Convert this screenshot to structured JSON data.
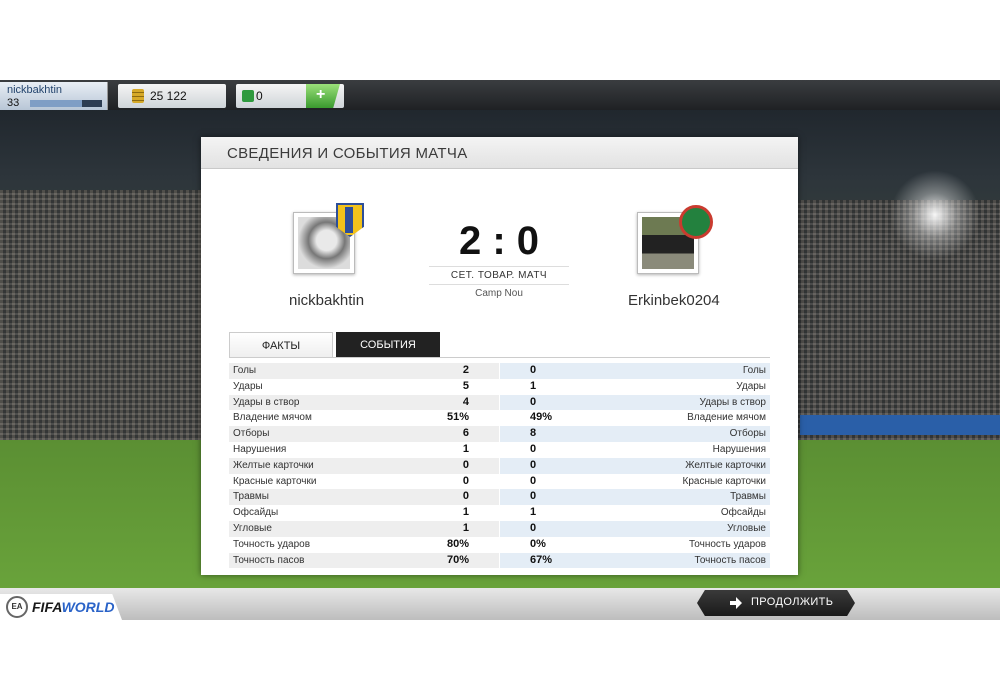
{
  "topbar": {
    "username": "nickbakhtin",
    "level": "33",
    "level_progress": 0.72,
    "coins": "25 122",
    "points": "0",
    "add_points_icon": "plus-icon"
  },
  "panel": {
    "title": "СВЕДЕНИЯ И СОБЫТИЯ МАТЧА",
    "home_player": "nickbakhtin",
    "away_player": "Erkinbek0204",
    "score": "2 : 0",
    "match_type": "СЕТ. ТОВАР. МАТЧ",
    "venue": "Camp Nou",
    "tabs": [
      {
        "label": "ФАКТЫ",
        "active": true
      },
      {
        "label": "СОБЫТИЯ",
        "active": false
      }
    ],
    "stats": [
      {
        "label": "Голы",
        "home": "2",
        "away": "0"
      },
      {
        "label": "Удары",
        "home": "5",
        "away": "1"
      },
      {
        "label": "Удары в створ",
        "home": "4",
        "away": "0"
      },
      {
        "label": "Владение мячом",
        "home": "51%",
        "away": "49%"
      },
      {
        "label": "Отборы",
        "home": "6",
        "away": "8"
      },
      {
        "label": "Нарушения",
        "home": "1",
        "away": "0"
      },
      {
        "label": "Желтые карточки",
        "home": "0",
        "away": "0"
      },
      {
        "label": "Красные карточки",
        "home": "0",
        "away": "0"
      },
      {
        "label": "Травмы",
        "home": "0",
        "away": "0"
      },
      {
        "label": "Офсайды",
        "home": "1",
        "away": "1"
      },
      {
        "label": "Угловые",
        "home": "1",
        "away": "0"
      },
      {
        "label": "Точность ударов",
        "home": "80%",
        "away": "0%"
      },
      {
        "label": "Точность пасов",
        "home": "70%",
        "away": "67%"
      }
    ]
  },
  "footer": {
    "logo_prefix": "FIFA",
    "logo_suffix": "WORLD",
    "ea_badge": "EA",
    "continue_label": "ПРОДОЛЖИТЬ",
    "continue_icon": "arrow-right-icon"
  },
  "colors": {
    "accent_blue": "#2a63c8",
    "add_button_green": "#3a9a2e",
    "dark_button": "#1a1a1a"
  }
}
